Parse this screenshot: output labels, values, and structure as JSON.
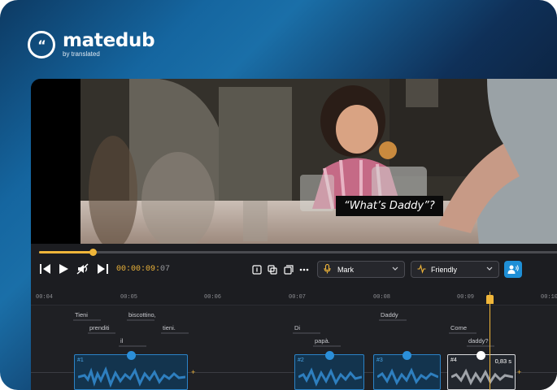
{
  "brand": {
    "name": "matedub",
    "tagline": "by translated",
    "mark": "“"
  },
  "video": {
    "subtitle": "“What’s Daddy”?"
  },
  "player": {
    "progress": 0.102,
    "timecode_main": "00:00:09:",
    "timecode_frames": "07"
  },
  "dropdowns": {
    "voice": {
      "label": "Mark",
      "icon": "microphone-icon"
    },
    "tone": {
      "label": "Friendly",
      "icon": "waveform-icon"
    }
  },
  "ruler": {
    "ticks": [
      "00:04",
      "00:05",
      "00:06",
      "00:07",
      "00:08",
      "00:09",
      "00:10"
    ]
  },
  "transcript": {
    "words": [
      "Tieni",
      "biscottino,",
      "prenditi",
      "tieni.",
      "il",
      "Di",
      "papà.",
      "Daddy",
      "Come",
      "daddy?"
    ]
  },
  "clips": [
    {
      "label": "#1",
      "duration": ""
    },
    {
      "label": "#2",
      "duration": ""
    },
    {
      "label": "#3",
      "duration": ""
    },
    {
      "label": "#4",
      "duration": "0,83 s"
    }
  ],
  "colors": {
    "accent": "#f0b63a",
    "clip_blue": "#2b83c7",
    "button_blue": "#1f8fd6"
  }
}
